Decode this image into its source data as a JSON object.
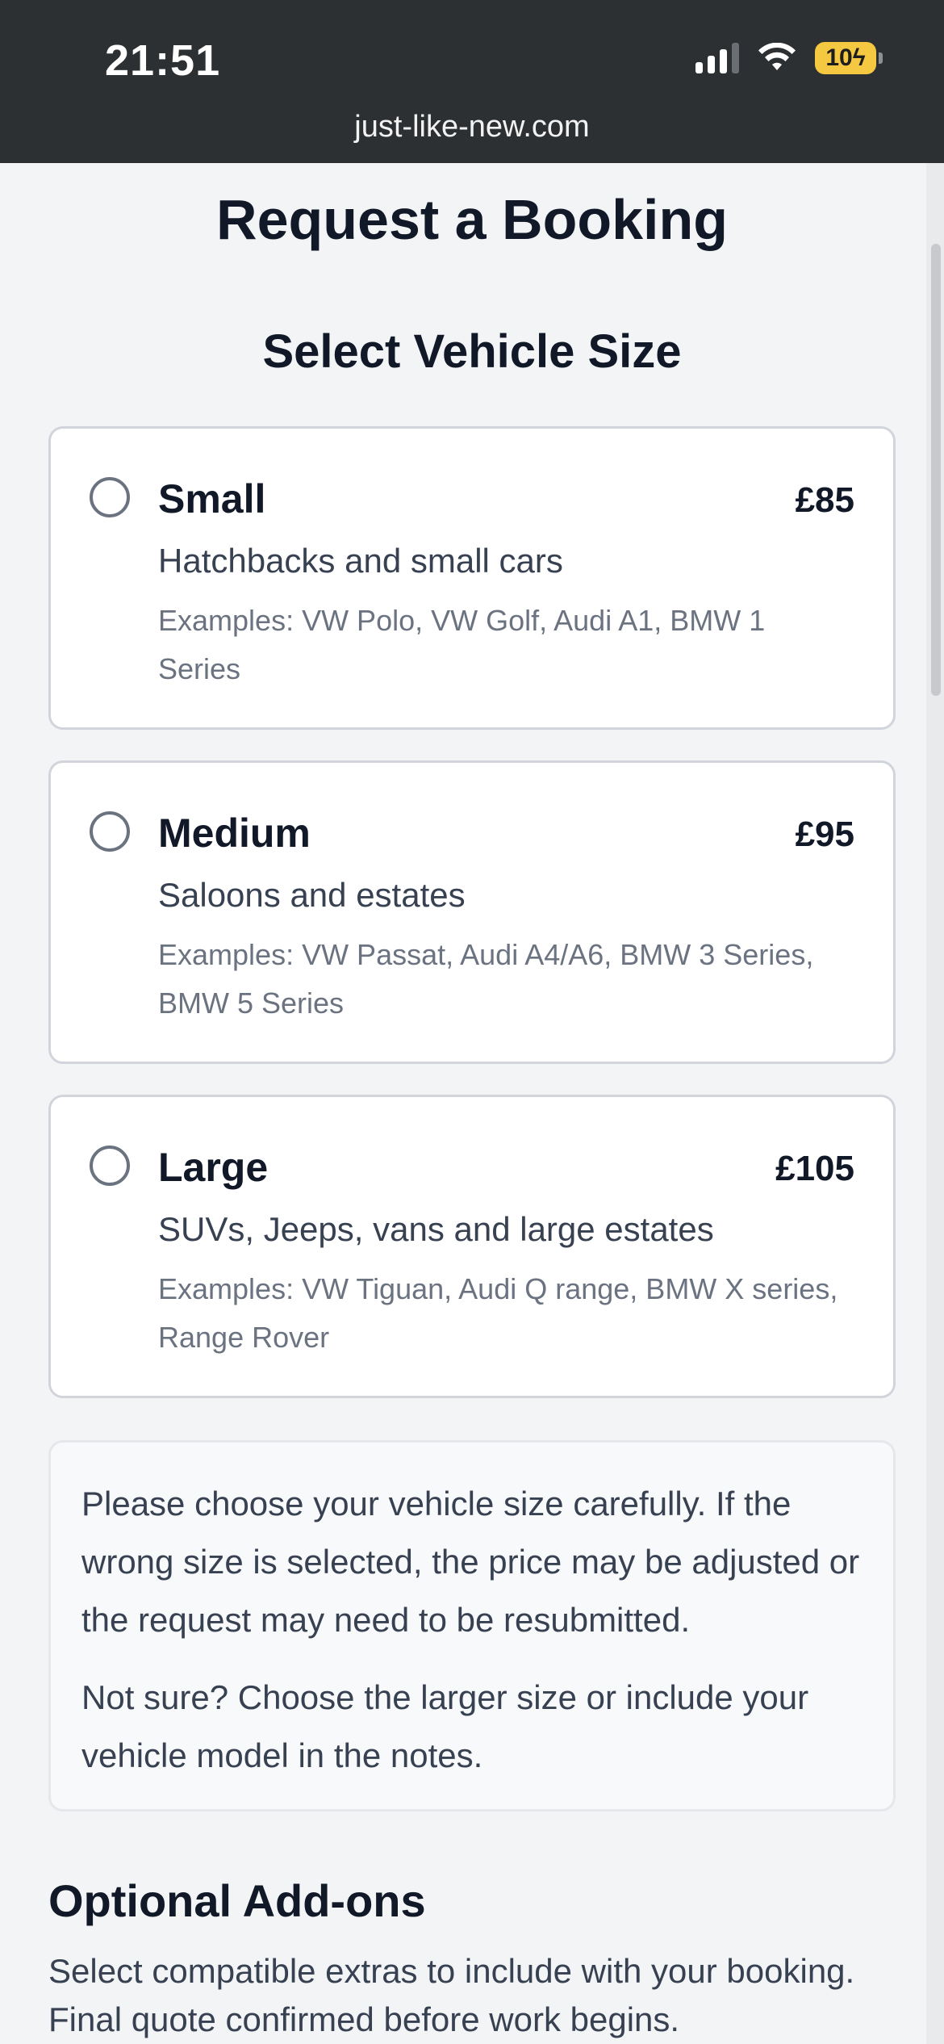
{
  "status_bar": {
    "time": "21:51",
    "battery": "10"
  },
  "browser": {
    "url": "just-like-new.com"
  },
  "page": {
    "title": "Request a Booking",
    "section_title": "Select Vehicle Size",
    "vehicle_sizes": [
      {
        "name": "Small",
        "price": "£85",
        "description": "Hatchbacks and small cars",
        "examples": "Examples: VW Polo, VW Golf, Audi A1, BMW 1 Series",
        "selected": false
      },
      {
        "name": "Medium",
        "price": "£95",
        "description": "Saloons and estates",
        "examples": "Examples: VW Passat, Audi A4/A6, BMW 3 Series, BMW 5 Series",
        "selected": false
      },
      {
        "name": "Large",
        "price": "£105",
        "description": "SUVs, Jeeps, vans and large estates",
        "examples": "Examples: VW Tiguan, Audi Q range, BMW X series, Range Rover",
        "selected": false
      }
    ],
    "notice": {
      "paragraph_1": "Please choose your vehicle size carefully. If the wrong size is selected, the price may be adjusted or the request may need to be resubmitted.",
      "paragraph_2": "Not sure? Choose the larger size or include your vehicle model in the notes."
    },
    "addons": {
      "title": "Optional Add-ons",
      "description": "Select compatible extras to include with your booking. Final quote confirmed before work begins."
    }
  }
}
